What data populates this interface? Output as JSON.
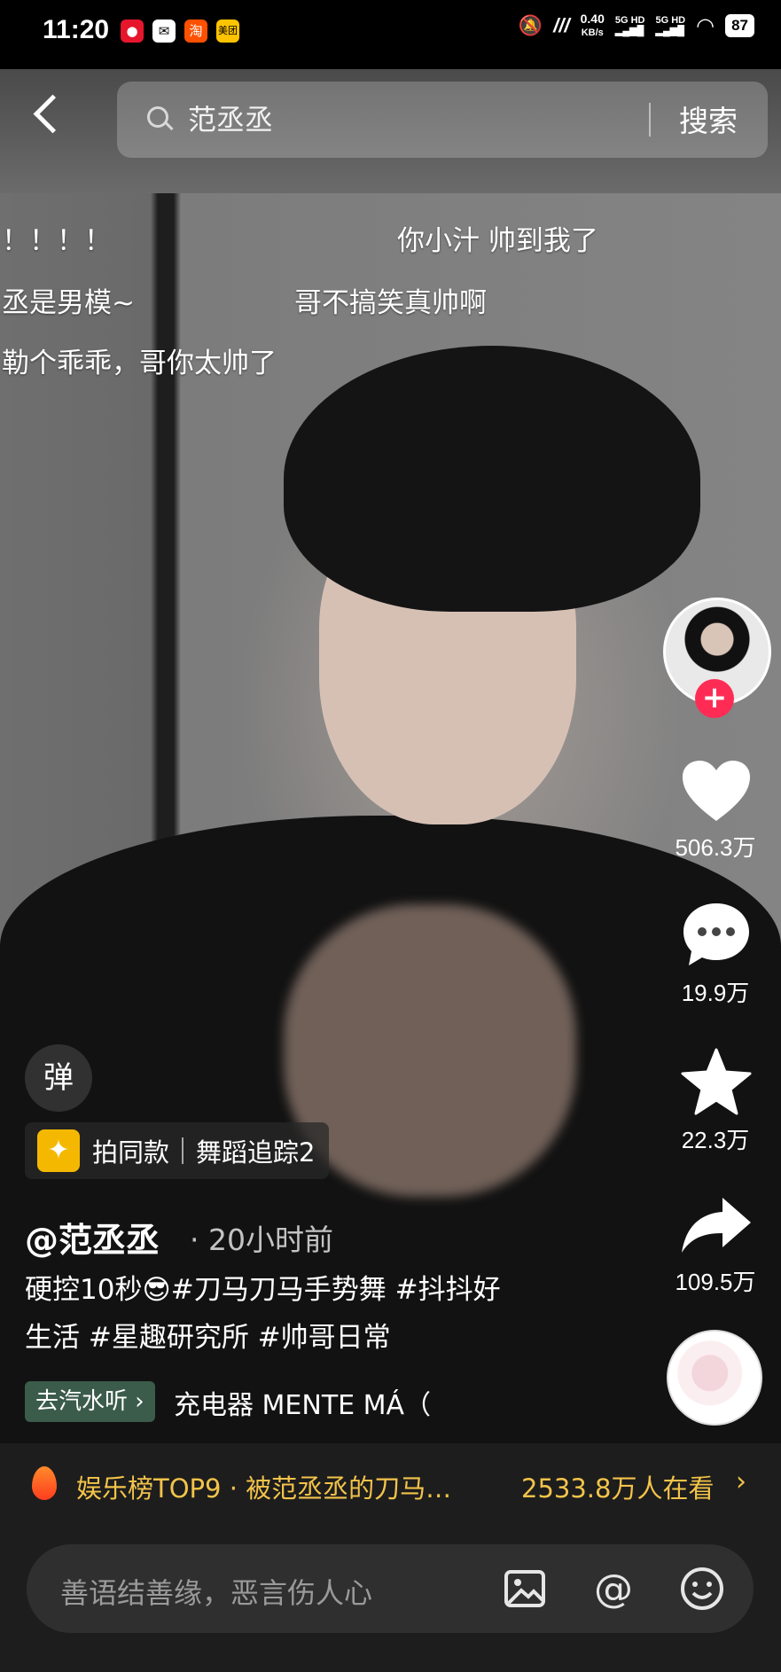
{
  "status_bar": {
    "time": "11:20",
    "network_speed_value": "0.40",
    "network_speed_unit": "KB/s",
    "net1": "5G HD",
    "net2": "5G HD",
    "battery": "87",
    "app_icons": [
      "weibo-icon",
      "message-icon",
      "taobao-icon",
      "meituan-icon"
    ],
    "meituan_label": "美团"
  },
  "search": {
    "query": "范丞丞",
    "button_label": "搜索"
  },
  "danmaku": [
    {
      "text": "！！！！"
    },
    {
      "text": "你小汁 帅到我了"
    },
    {
      "text": "丞是男模~"
    },
    {
      "text": "哥不搞笑真帅啊"
    },
    {
      "text": "勒个乖乖，哥你太帅了"
    }
  ],
  "actions": {
    "likes": "506.3万",
    "comments": "19.9万",
    "favorites": "22.3万",
    "shares": "109.5万"
  },
  "video_info": {
    "danmu_toggle": "弹",
    "same_style_label": "拍同款",
    "dance_label": "舞蹈追踪2",
    "author": "@范丞丞",
    "time_ago": "· 20小时前",
    "caption_line1": "硬控10秒😎#刀马刀马手势舞 #抖抖好",
    "caption_line2": "生活 #星趣研究所 #帅哥日常",
    "music_tag": "去汽水听 ›",
    "music_name": "充电器     MENTE MÁ（"
  },
  "trending": {
    "text": "娱乐榜TOP9 · 被范丞丞的刀马…",
    "viewers": "2533.8万人在看",
    "arrow": "›"
  },
  "comment_bar": {
    "placeholder": "善语结善缘，恶言伤人心"
  },
  "colors": {
    "accent_red": "#fe2c55",
    "trend_gold": "#f3c34a"
  }
}
